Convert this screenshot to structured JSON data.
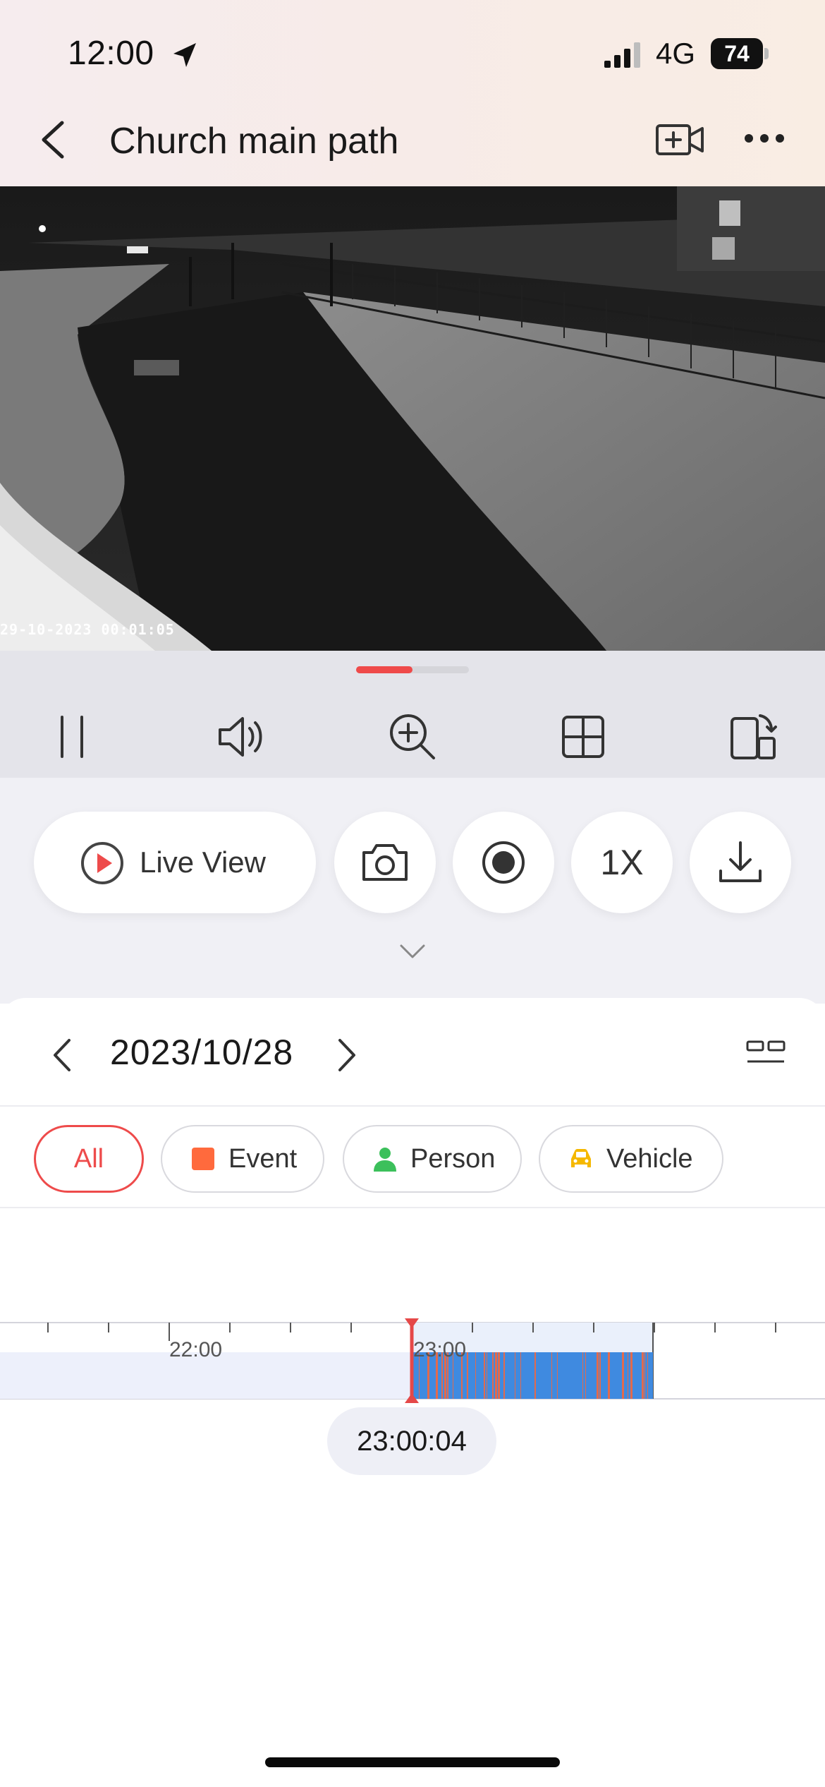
{
  "status_bar": {
    "time": "12:00",
    "network": "4G",
    "battery": "74",
    "icons": [
      "location-arrow-icon",
      "cellular-signal-icon",
      "battery-icon"
    ]
  },
  "nav": {
    "title": "Church main path",
    "icons": [
      "back-chevron-icon",
      "add-camera-icon",
      "more-dots-icon"
    ]
  },
  "video": {
    "osd_timestamp": "29-10-2023 00:01:05"
  },
  "controls": {
    "icons": [
      "pause-icon",
      "speaker-icon",
      "zoom-in-icon",
      "grid-icon",
      "rotate-device-icon"
    ]
  },
  "actions": {
    "live_view_label": "Live View",
    "speed_label": "1X",
    "icons": [
      "play-circle-icon",
      "camera-icon",
      "record-icon",
      "download-icon",
      "chevron-down-icon"
    ]
  },
  "date_bar": {
    "date": "2023/10/28",
    "icons": [
      "prev-date-icon",
      "next-date-icon",
      "layout-toggle-icon"
    ]
  },
  "filters": {
    "all": "All",
    "event": "Event",
    "person": "Person",
    "vehicle": "Vehicle",
    "colors": {
      "active": "#ee4b4b",
      "event": "#ff6a3d",
      "person": "#3cc05b",
      "vehicle": "#f5b800"
    }
  },
  "timeline": {
    "tick_labels": [
      "22:00",
      "23:00"
    ],
    "current_time": "23:00:04",
    "colors": {
      "recording_base": "#3f8ae0",
      "event_stripe": "#e26a4d",
      "playhead": "#e54848"
    }
  }
}
